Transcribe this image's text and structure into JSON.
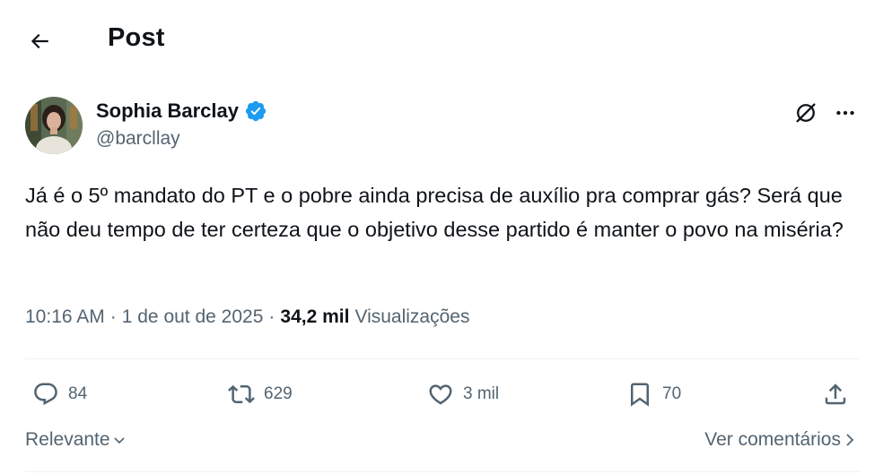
{
  "header": {
    "title": "Post",
    "back_icon": "arrow-left-icon"
  },
  "author": {
    "name": "Sophia Barclay",
    "handle": "@barcllay",
    "verified_color": "#1d9bf0"
  },
  "post": {
    "text": "Já é o 5º mandato do PT e o pobre ainda precisa de auxílio pra comprar gás? Será que não deu tempo de ter certeza que o objetivo desse partido é manter o povo na miséria?",
    "time": "10:16 AM",
    "date": "1 de out de 2025",
    "views_count": "34,2 mil",
    "views_label": "Visualizações"
  },
  "actions": {
    "replies": "84",
    "reposts": "629",
    "likes": "3 mil",
    "bookmarks": "70"
  },
  "footer": {
    "sort_label": "Relevante",
    "comments_link": "Ver comentários"
  },
  "colors": {
    "text": "#0f1419",
    "secondary": "#536471",
    "accent": "#1d9bf0",
    "divider": "#eff3f4"
  }
}
